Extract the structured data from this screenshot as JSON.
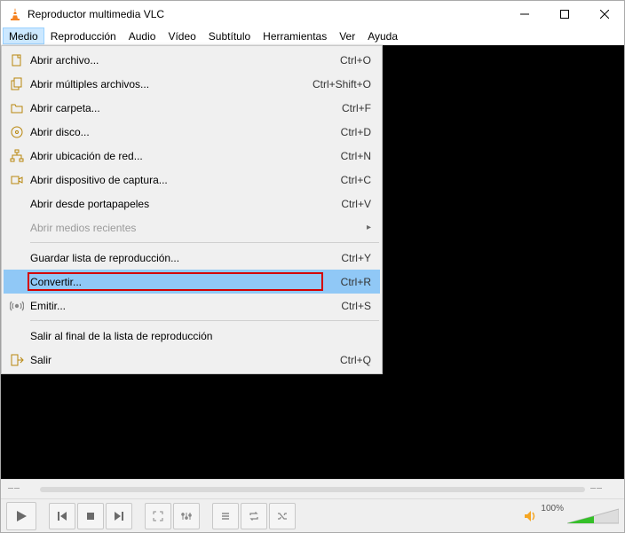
{
  "window": {
    "title": "Reproductor multimedia VLC"
  },
  "menubar": [
    "Medio",
    "Reproducción",
    "Audio",
    "Vídeo",
    "Subtítulo",
    "Herramientas",
    "Ver",
    "Ayuda"
  ],
  "menu_active_index": 0,
  "dropdown": {
    "items": [
      {
        "icon": "file",
        "label": "Abrir archivo...",
        "shortcut": "Ctrl+O"
      },
      {
        "icon": "files",
        "label": "Abrir múltiples archivos...",
        "shortcut": "Ctrl+Shift+O"
      },
      {
        "icon": "folder",
        "label": "Abrir carpeta...",
        "shortcut": "Ctrl+F"
      },
      {
        "icon": "disc",
        "label": "Abrir disco...",
        "shortcut": "Ctrl+D"
      },
      {
        "icon": "network",
        "label": "Abrir ubicación de red...",
        "shortcut": "Ctrl+N"
      },
      {
        "icon": "capture",
        "label": "Abrir dispositivo de captura...",
        "shortcut": "Ctrl+C"
      },
      {
        "icon": "",
        "label": "Abrir desde portapapeles",
        "shortcut": "Ctrl+V"
      },
      {
        "icon": "",
        "label": "Abrir medios recientes",
        "shortcut": "",
        "disabled": true,
        "submenu": true
      },
      {
        "sep": true
      },
      {
        "icon": "",
        "label": "Guardar lista de reproducción...",
        "shortcut": "Ctrl+Y"
      },
      {
        "icon": "",
        "label": "Convertir...",
        "shortcut": "Ctrl+R",
        "selected": true
      },
      {
        "icon": "stream",
        "label": "Emitir...",
        "shortcut": "Ctrl+S"
      },
      {
        "sep": true
      },
      {
        "icon": "",
        "label": "Salir al final de la lista de reproducción",
        "shortcut": ""
      },
      {
        "icon": "exit",
        "label": "Salir",
        "shortcut": "Ctrl+Q"
      }
    ]
  },
  "volume": {
    "label": "100%"
  }
}
